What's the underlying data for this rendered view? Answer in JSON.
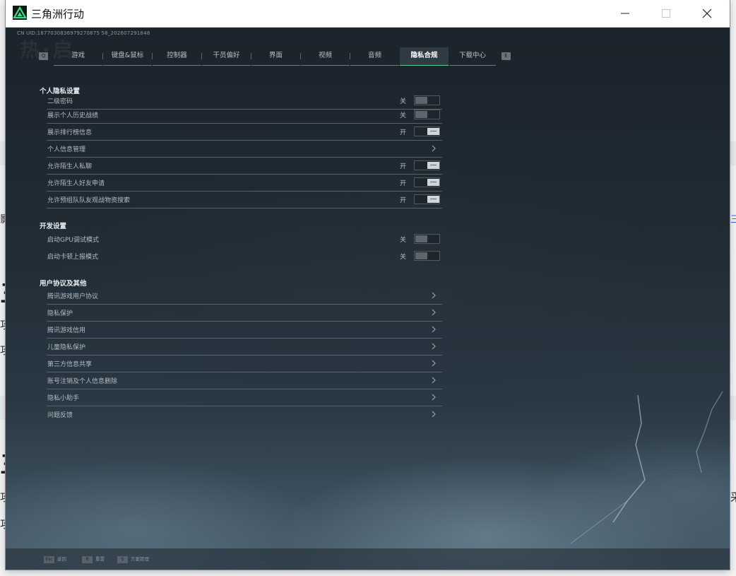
{
  "window": {
    "title": "三角洲行动"
  },
  "background": {
    "fragment_left": "影",
    "fragment_right": "三",
    "big_a": "三",
    "big_b": "三",
    "line_a": "攻",
    "line_b": "攻",
    "line_c": "攻",
    "line_d": "攻",
    "right_tail": "采"
  },
  "game": {
    "uid": "CN UID:1877030836979270875 58_202607291848",
    "scrawl": "热·启",
    "key_prev": "Q",
    "key_next": "E",
    "tabs": [
      {
        "label": "游戏"
      },
      {
        "label": "键盘&鼠标"
      },
      {
        "label": "控制器"
      },
      {
        "label": "干员偏好"
      },
      {
        "label": "界面"
      },
      {
        "label": "视频"
      },
      {
        "label": "音频"
      },
      {
        "label": "隐私合规"
      },
      {
        "label": "下载中心"
      }
    ],
    "active_tab": "隐私合规",
    "sections": {
      "privacy": {
        "title": "个人隐私设置",
        "rows": [
          {
            "label": "二级密码",
            "state": "关"
          },
          {
            "label": "展示个人历史战绩",
            "state": "关"
          },
          {
            "label": "展示排行榜信息",
            "state": "开"
          },
          {
            "label": "个人信息管理"
          },
          {
            "label": "允许陌生人私聊",
            "state": "开"
          },
          {
            "label": "允许陌生人好友申请",
            "state": "开"
          },
          {
            "label": "允许预组队队友观战物资搜索",
            "state": "开"
          }
        ]
      },
      "dev": {
        "title": "开发设置",
        "rows": [
          {
            "label": "启动GPU调试模式",
            "state": "关"
          },
          {
            "label": "启动卡顿上报模式",
            "state": "关"
          }
        ]
      },
      "agreements": {
        "title": "用户协议及其他",
        "rows": [
          {
            "label": "腾讯游戏用户协议"
          },
          {
            "label": "隐私保护"
          },
          {
            "label": "腾讯游戏信用"
          },
          {
            "label": "儿童隐私保护"
          },
          {
            "label": "第三方信息共享"
          },
          {
            "label": "账号注销及个人信息删除"
          },
          {
            "label": "隐私小助手"
          },
          {
            "label": "问题反馈"
          }
        ]
      }
    },
    "bottom_hints": [
      {
        "key": "Esc",
        "label": "返回"
      },
      {
        "key": "R",
        "label": "重置"
      },
      {
        "key": "S",
        "label": "方案管理"
      }
    ]
  },
  "colors": {
    "accent": "#5bd08f",
    "panel_text": "#b3bcc1",
    "section_title": "#e6ebee"
  },
  "icons": {
    "app": "delta-triangle-icon",
    "minimize": "minimize-icon",
    "maximize": "maximize-icon",
    "close": "close-icon",
    "row_arrow": "chevron-right-icon"
  }
}
